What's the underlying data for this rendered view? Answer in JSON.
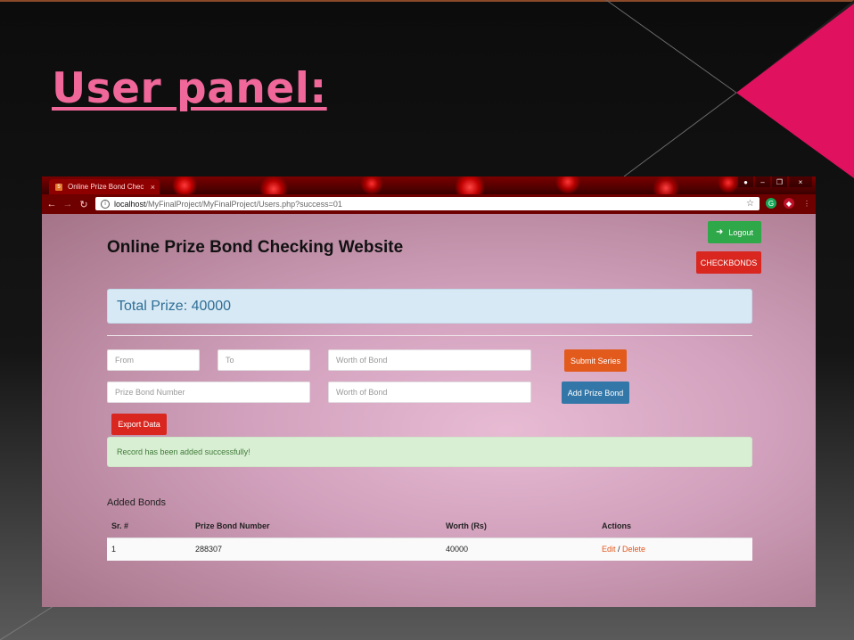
{
  "slide": {
    "title": "User panel:"
  },
  "browser": {
    "tab_title": "Online Prize Bond Chec",
    "tab_close": "×",
    "tab_favicon": "html-icon",
    "win_controls": {
      "minimize": "–",
      "maximize": "❐",
      "close": "×"
    },
    "url_host": "localhost",
    "url_path": "/MyFinalProject/MyFinalProject/Users.php?success=01",
    "extension_icons": [
      "grammarly-icon",
      "shield-extension-icon",
      "menu-dots-icon"
    ]
  },
  "page": {
    "title": "Online Prize Bond Checking Website",
    "logout_label": "Logout",
    "checkbonds_label": "CHECKBONDS",
    "total_prize": "Total Prize: 40000",
    "form": {
      "from_placeholder": "From",
      "to_placeholder": "To",
      "worth_placeholder_1": "Worth of Bond",
      "submit_series_label": "Submit Series",
      "bond_number_placeholder": "Prize Bond Number",
      "worth_placeholder_2": "Worth of Bond",
      "add_bond_label": "Add Prize Bond",
      "export_label": "Export Data"
    },
    "alert": "Record has been added successfully!",
    "section_title": "Added Bonds",
    "table": {
      "headers": [
        "Sr. #",
        "Prize Bond Number",
        "Worth (Rs)",
        "Actions"
      ],
      "rows": [
        {
          "sr": "1",
          "number": "288307",
          "worth": "40000",
          "edit": "Edit",
          "sep": " / ",
          "delete": "Delete"
        }
      ]
    }
  },
  "colors": {
    "title_pink": "#f0679a",
    "accent_magenta": "#e0115f",
    "logout_green": "#2fa84a",
    "danger_red": "#d9261f",
    "submit_orange": "#e25a1c",
    "add_blue": "#3377a8"
  }
}
